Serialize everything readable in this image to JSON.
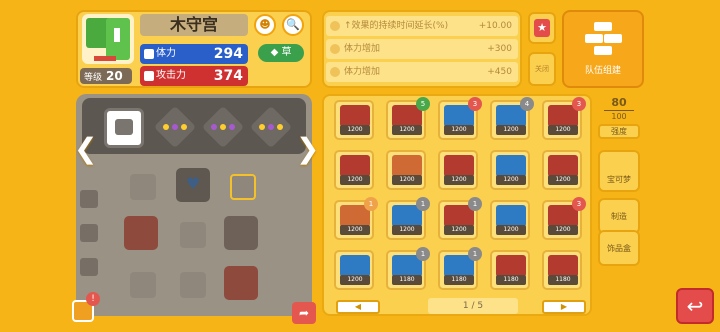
{
  "pokemon": {
    "name": "木守宫",
    "level_label": "等级",
    "level": "20",
    "hp_label": "体力",
    "hp": "294",
    "atk_label": "攻击力",
    "atk": "374",
    "type": "草"
  },
  "effects": [
    {
      "label": "↑效果的持续时间延长(%)",
      "value": "+10.00"
    },
    {
      "label": "体力增加",
      "value": "+300"
    },
    {
      "label": "体力增加",
      "value": "+450"
    }
  ],
  "team_button_label": "队伍组建",
  "lock_label": "关闭",
  "strength": {
    "value": "80",
    "max": "100",
    "label": "强度"
  },
  "side_menu": [
    "宝可梦",
    "制造",
    "饰品盒"
  ],
  "tiles": [
    {
      "label": "1200",
      "badge": "",
      "badge_color": "",
      "color": "#b23a2e"
    },
    {
      "label": "1200",
      "badge": "5",
      "badge_color": "#49a84a",
      "color": "#b23a2e"
    },
    {
      "label": "1200",
      "badge": "3",
      "badge_color": "#e4574e",
      "color": "#2f7bc3"
    },
    {
      "label": "1200",
      "badge": "4",
      "badge_color": "#8a8a8a",
      "color": "#2f7bc3"
    },
    {
      "label": "1200",
      "badge": "3",
      "badge_color": "#e4574e",
      "color": "#b23a2e"
    },
    {
      "label": "1200",
      "badge": "",
      "badge_color": "",
      "color": "#b23a2e"
    },
    {
      "label": "1200",
      "badge": "",
      "badge_color": "",
      "color": "#cf6a34"
    },
    {
      "label": "1200",
      "badge": "",
      "badge_color": "",
      "color": "#b23a2e"
    },
    {
      "label": "1200",
      "badge": "",
      "badge_color": "",
      "color": "#2f7bc3"
    },
    {
      "label": "1200",
      "badge": "",
      "badge_color": "",
      "color": "#b23a2e"
    },
    {
      "label": "1200",
      "badge": "1",
      "badge_color": "#f0a24a",
      "color": "#cf6a34"
    },
    {
      "label": "1200",
      "badge": "1",
      "badge_color": "#8a8a8a",
      "color": "#2f7bc3"
    },
    {
      "label": "1200",
      "badge": "1",
      "badge_color": "#8a8a8a",
      "color": "#b23a2e"
    },
    {
      "label": "1200",
      "badge": "",
      "badge_color": "",
      "color": "#2f7bc3"
    },
    {
      "label": "1200",
      "badge": "3",
      "badge_color": "#e4574e",
      "color": "#b23a2e"
    },
    {
      "label": "1200",
      "badge": "",
      "badge_color": "",
      "color": "#2f7bc3"
    },
    {
      "label": "1180",
      "badge": "1",
      "badge_color": "#8a8a8a",
      "color": "#2f7bc3"
    },
    {
      "label": "1180",
      "badge": "1",
      "badge_color": "#8a8a8a",
      "color": "#2f7bc3"
    },
    {
      "label": "1180",
      "badge": "",
      "badge_color": "",
      "color": "#b23a2e"
    },
    {
      "label": "1180",
      "badge": "",
      "badge_color": "",
      "color": "#b23a2e"
    }
  ],
  "pagination": {
    "text": "1 / 5",
    "prev": "◀",
    "next": "▶"
  },
  "colors": {
    "bg": "#f7b417",
    "hp": "#2a5ec9",
    "atk": "#cf3131",
    "type": "#3aa04c"
  }
}
